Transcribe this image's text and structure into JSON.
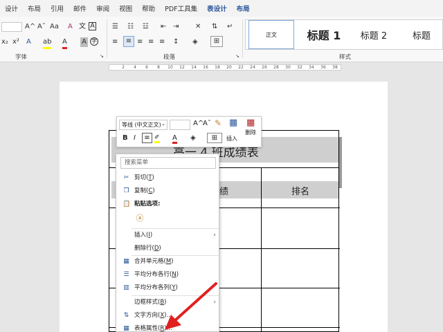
{
  "tabs": [
    "设计",
    "布局",
    "引用",
    "邮件",
    "审阅",
    "视图",
    "帮助",
    "PDF工具集",
    "表设计",
    "布局"
  ],
  "ribbon": {
    "font_size_label": "",
    "grow_font": "A^",
    "shrink_font": "Aˇ",
    "change_case": "Aa",
    "clear_format": "A",
    "pinyin": "文",
    "char_border": "A",
    "subscript": "x₂",
    "superscript": "x²",
    "text_effect": "A",
    "highlight": "ab",
    "font_color": "A",
    "char_shading": "A",
    "enclose": "字",
    "group_font": "字体",
    "group_paragraph": "段落",
    "group_styles": "样式",
    "styles": [
      "正文",
      "标题 1",
      "标题 2",
      "标题"
    ]
  },
  "ruler": {
    "ticks": [
      "2",
      "4",
      "6",
      "8",
      "10",
      "12",
      "14",
      "16",
      "18",
      "20",
      "22",
      "24",
      "26",
      "28",
      "30",
      "32",
      "34",
      "36",
      "38"
    ]
  },
  "table": {
    "title": "高一 4 班成绩表",
    "header_score": "成绩",
    "header_rank": "排名"
  },
  "mini_toolbar": {
    "font_name": "等线 (中文正文)",
    "font_size": "",
    "grow": "A^",
    "shrink": "Aˇ",
    "bold": "B",
    "italic": "I",
    "insert_label": "插入",
    "delete_label": "删除"
  },
  "context_menu": {
    "search_placeholder": "搜索菜单",
    "items": [
      {
        "label": "剪切(",
        "key": "T",
        "tail": ")"
      },
      {
        "label": "复制(",
        "key": "C",
        "tail": ")"
      },
      {
        "label": "粘贴选项:",
        "key": "",
        "tail": ""
      },
      {
        "label": "插入(",
        "key": "I",
        "tail": ")"
      },
      {
        "label": "删除行(",
        "key": "D",
        "tail": ")"
      },
      {
        "label": "合并单元格(",
        "key": "M",
        "tail": ")"
      },
      {
        "label": "平均分布各行(",
        "key": "N",
        "tail": ")"
      },
      {
        "label": "平均分布各列(",
        "key": "Y",
        "tail": ")"
      },
      {
        "label": "边框样式(",
        "key": "B",
        "tail": ")"
      },
      {
        "label": "文字方向(",
        "key": "X",
        "tail": ")..."
      },
      {
        "label": "表格属性(",
        "key": "R",
        "tail": ")..."
      }
    ]
  },
  "colors": {
    "accent": "#2b579a",
    "arrow": "#e02020",
    "highlight": "#ffff00",
    "font_red": "#e02020"
  }
}
